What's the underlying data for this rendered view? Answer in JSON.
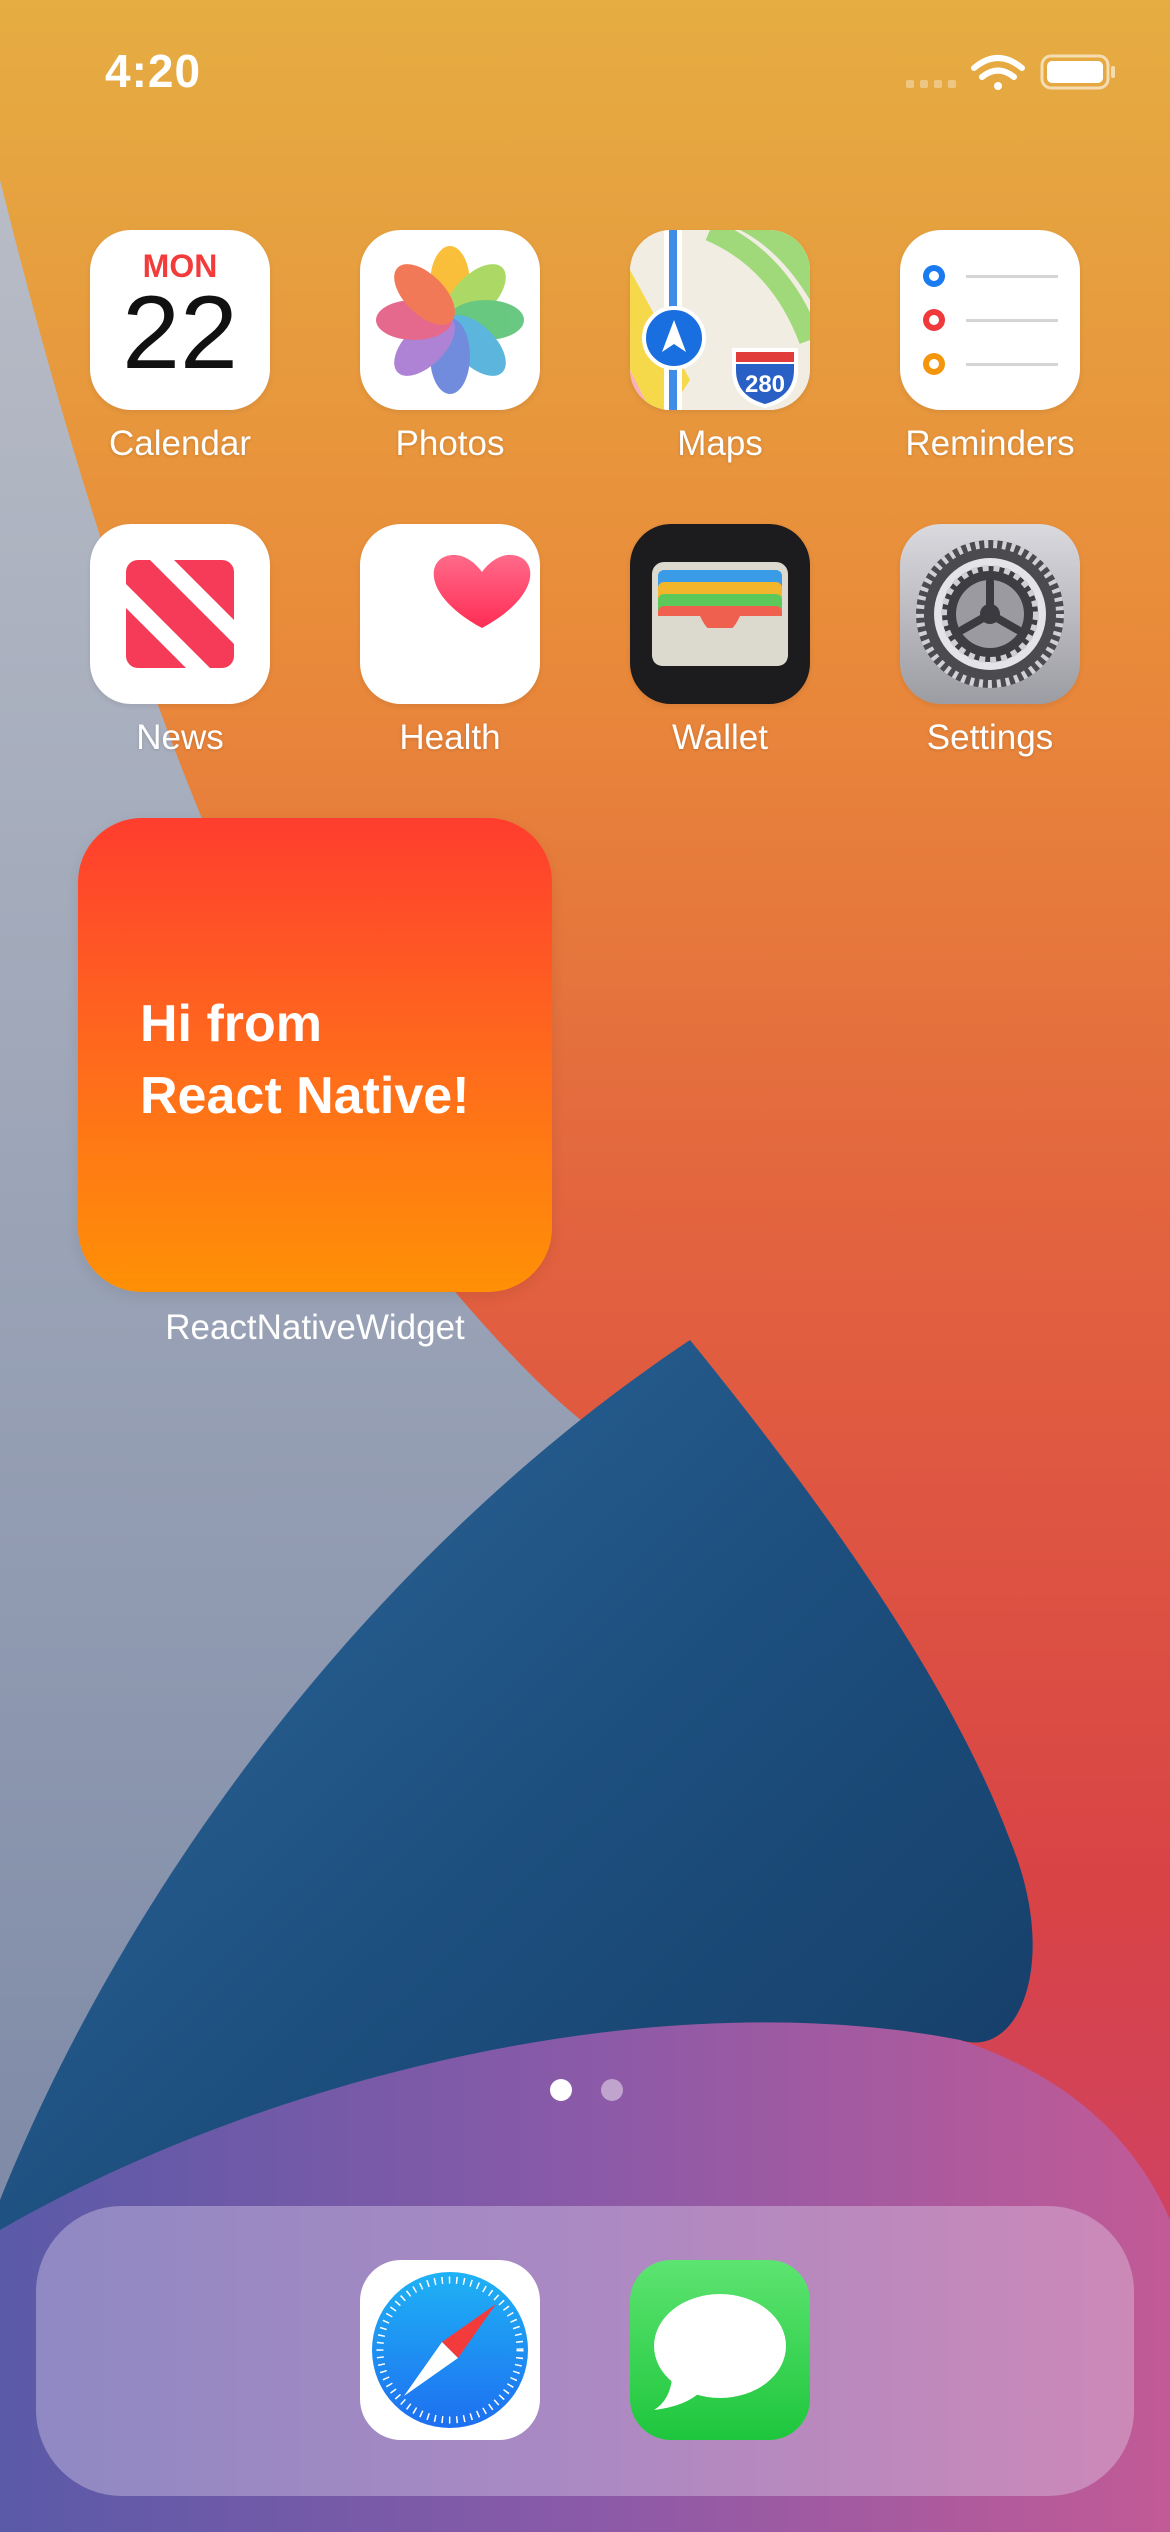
{
  "status_bar": {
    "time": "4:20",
    "icons": [
      "cellular-dots-icon",
      "wifi-icon",
      "battery-icon"
    ]
  },
  "apps": [
    {
      "label": "Calendar",
      "icon": "calendar-icon",
      "weekday": "MON",
      "day": "22"
    },
    {
      "label": "Photos",
      "icon": "photos-icon"
    },
    {
      "label": "Maps",
      "icon": "maps-icon",
      "route_number": "280"
    },
    {
      "label": "Reminders",
      "icon": "reminders-icon"
    },
    {
      "label": "News",
      "icon": "news-icon"
    },
    {
      "label": "Health",
      "icon": "health-icon"
    },
    {
      "label": "Wallet",
      "icon": "wallet-icon"
    },
    {
      "label": "Settings",
      "icon": "settings-icon"
    }
  ],
  "widget": {
    "line1": "Hi from",
    "line2": "React Native!",
    "label": "ReactNativeWidget"
  },
  "page_indicator": {
    "pages": 2,
    "current": 1
  },
  "dock": {
    "apps": [
      {
        "icon": "safari-icon"
      },
      {
        "icon": "messages-icon"
      }
    ]
  },
  "colors": {
    "calendar_red": "#f23c3c",
    "widget_top": "#ff3d2e",
    "widget_bottom": "#ff9006",
    "messages_green": "#2fd158",
    "safari_blue": "#1f8ef1"
  }
}
